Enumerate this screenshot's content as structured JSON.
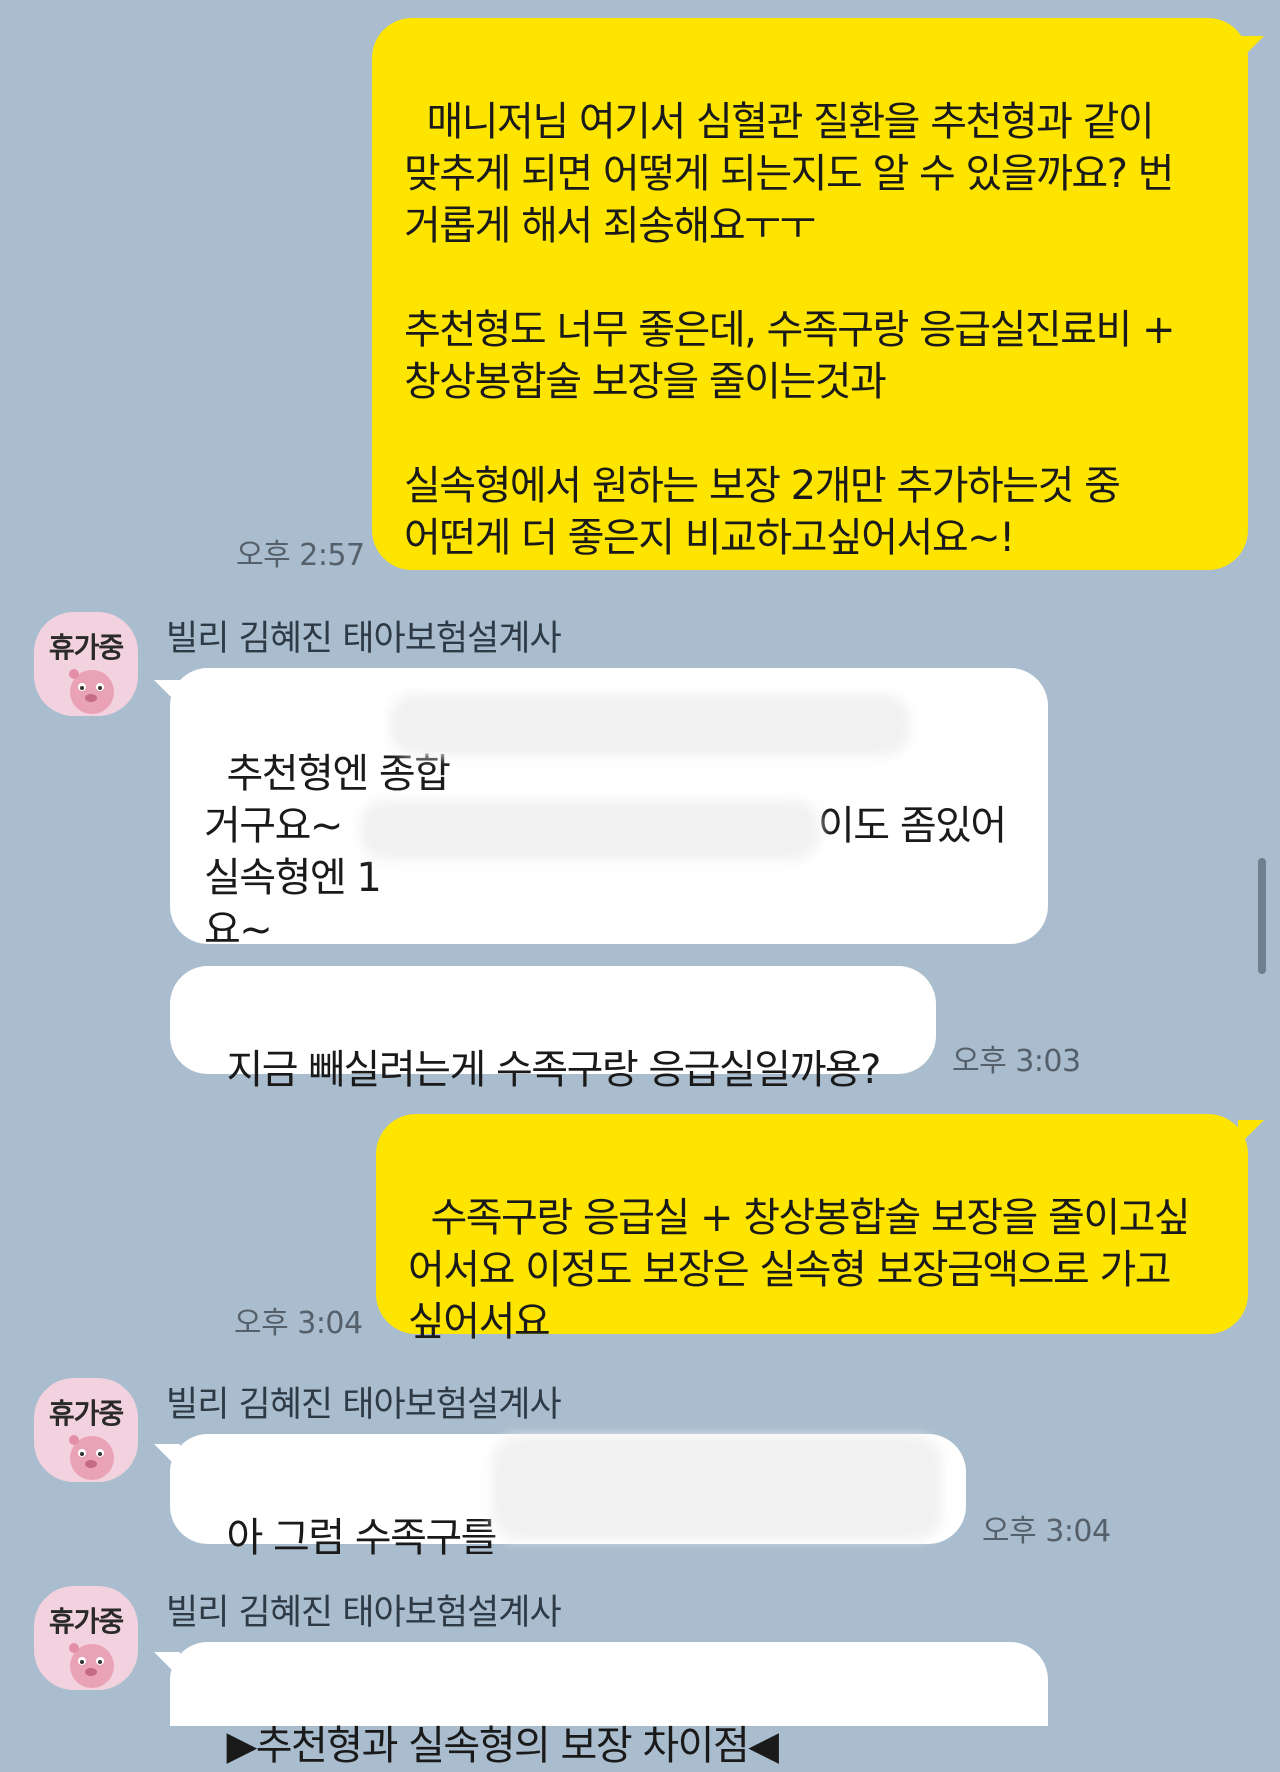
{
  "messages": [
    {
      "direction": "outgoing",
      "text": "매니저님 여기서 심혈관 질환을 추천형과 같이\n맞추게 되면 어떻게 되는지도 알 수 있을까요? 번\n거롭게 해서 죄송해요ㅜㅜ\n\n추천형도 너무 좋은데, 수족구랑 응급실진료비 +\n창상봉합술 보장을 줄이는것과\n\n실속형에서 원하는 보장 2개만 추가하는것 중\n어떤게 더 좋은지 비교하고싶어서요~!",
      "time": "오후 2:57"
    },
    {
      "direction": "incoming",
      "sender": "빌리 김혜진 태아보험설계사",
      "avatar_label": "휴가중",
      "bubbles": [
        {
          "text": "추천형엔 종합\n거구요~\n실속형엔 1\n요~",
          "tail": "이도 좀있어",
          "blurred": true
        },
        {
          "text": "지금 빼실려는게 수족구랑 응급실일까용?",
          "time": "오후 3:03"
        }
      ]
    },
    {
      "direction": "outgoing",
      "text": "수족구랑 응급실 + 창상봉합술 보장을 줄이고싶\n어서요 이정도 보장은 실속형 보장금액으로 가고\n싶어서요",
      "time": "오후 3:04"
    },
    {
      "direction": "incoming",
      "sender": "빌리 김혜진 태아보험설계사",
      "avatar_label": "휴가중",
      "bubbles": [
        {
          "text": "아 그럼 수족구를",
          "blurred": true,
          "time": "오후 3:04"
        }
      ]
    },
    {
      "direction": "incoming",
      "sender": "빌리 김혜진 태아보험설계사",
      "avatar_label": "휴가중",
      "bubbles": [
        {
          "text": "▶추천형과 실속형의 보장 차이점◀"
        }
      ]
    }
  ],
  "colors": {
    "background": "#a9bdce",
    "outgoing_bubble": "#fee500",
    "incoming_bubble": "#ffffff",
    "avatar_bg": "#f3d2df"
  }
}
